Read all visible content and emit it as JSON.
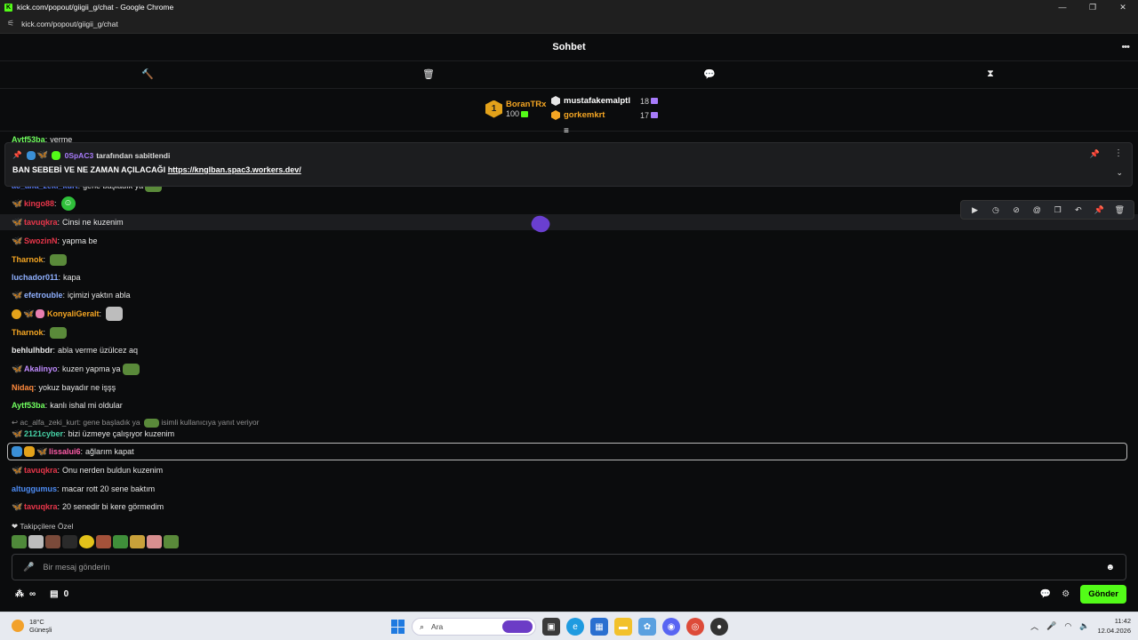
{
  "browser": {
    "title": "kick.com/popout/giigii_g/chat - Google Chrome",
    "url": "kick.com/popout/giigii_g/chat",
    "logo": "K"
  },
  "chat": {
    "title": "Sohbet"
  },
  "leaderboard": {
    "top": {
      "rank": "1",
      "user": "BoranTRx",
      "count": "100"
    },
    "others": [
      {
        "user": "mustafakemalptl",
        "count": "18",
        "color": "#ffffff"
      },
      {
        "user": "gorkemkrt",
        "count": "17",
        "color": "#f5a623"
      }
    ]
  },
  "pinned": {
    "by_user": "0SpAC3",
    "by_suffix": "tarafından sabitlendi",
    "text": "BAN SEBEBİ VE NE ZAMAN AÇILACAĞI ",
    "link": "https://knglban.spac3.workers.dev/"
  },
  "messages": [
    {
      "user": "Aytf53ba",
      "text": "verme",
      "color": "#71ff5f"
    },
    {
      "user": "ac_alfa_zeki_kurt",
      "text": "gene başladık ya",
      "color": "#5a7bf5"
    },
    {
      "user": "kingo88",
      "text": "",
      "color": "#e8364a"
    },
    {
      "user": "tavuqkra",
      "text": "Cinsi ne kuzenim",
      "color": "#e8364a"
    },
    {
      "user": "SwozinN",
      "text": "yapma be",
      "color": "#e8364a"
    },
    {
      "user": "Tharnok",
      "text": "",
      "color": "#f5a623"
    },
    {
      "user": "luchador011",
      "text": "kapa",
      "color": "#8fb0ff"
    },
    {
      "user": "efetrouble",
      "text": "içimizi yaktın abla",
      "color": "#8fb0ff"
    },
    {
      "user": "KonyaliGeralt",
      "text": "",
      "color": "#f5a623"
    },
    {
      "user": "Tharnok",
      "text": "",
      "color": "#f5a623"
    },
    {
      "user": "behlulhbdr",
      "text": "abla verme üzülcez aq",
      "color": "#e6e6e6"
    },
    {
      "user": "Akalinyo",
      "text": "kuzen yapma ya",
      "color": "#c08bff"
    },
    {
      "user": "Nidaq",
      "text": "yokuz bayadır ne işşş",
      "color": "#ff8a3d"
    },
    {
      "user": "Aytf53ba",
      "text": "kanlı ishal mi oldular",
      "color": "#71ff5f"
    },
    {
      "user": "2121cyber",
      "text": "bizi üzmeye çalışıyor kuzenim",
      "color": "#46d3a7"
    },
    {
      "user": "lissalui6",
      "text": "ağlarım kapat",
      "color": "#ff5ca8"
    },
    {
      "user": "tavuqkra",
      "text": "Onu nerden buldun kuzenim",
      "color": "#e8364a"
    },
    {
      "user": "altuggumus",
      "text": "macar rott 20 sene baktım",
      "color": "#4d8cf5"
    },
    {
      "user": "tavuqkra",
      "text": "20 senedir bi kere görmedim",
      "color": "#e8364a"
    }
  ],
  "reply": {
    "quoted": "ac_alfa_zeki_kurt: gene başladık ya",
    "suffix": "isimli kullanıcıya yanıt veriyor"
  },
  "followers_label": "Takipçilere Özel",
  "input": {
    "placeholder": "Bir mesaj gönderin"
  },
  "bottom": {
    "points": "0",
    "send_label": "Gönder"
  },
  "taskbar": {
    "temp": "18°C",
    "weather": "Güneşli",
    "search": "Ara",
    "time": "11:42",
    "date": "12.04.2026"
  },
  "icons": {
    "separator": ":",
    "butterfly": "🦋",
    "pin": "📌",
    "dots": "⋮",
    "chevron": "⌄",
    "hammer": "🔨",
    "trash": "🗑",
    "speech": "💬",
    "hourglass": "⧗",
    "collapse": "≡",
    "play": "▶",
    "clock": "◷",
    "mute": "⊘",
    "mention": "@",
    "copy": "❐",
    "undo": "↶",
    "heart": "❤",
    "mic": "🎤",
    "smile": "☻",
    "infinity": "∞",
    "chat": "💬",
    "gear": "⚙",
    "minimize": "—",
    "restore": "❐",
    "close": "✕",
    "tune": "⚟",
    "search": "⌕",
    "wifi": "◠",
    "speaker": "🔈",
    "reply_arrow": "↩",
    "kingo_badge": "☺"
  },
  "colors": {
    "accent": "#53fc18",
    "pinnedBy": "#a77bfa",
    "butterfly": "#f27ac6"
  }
}
